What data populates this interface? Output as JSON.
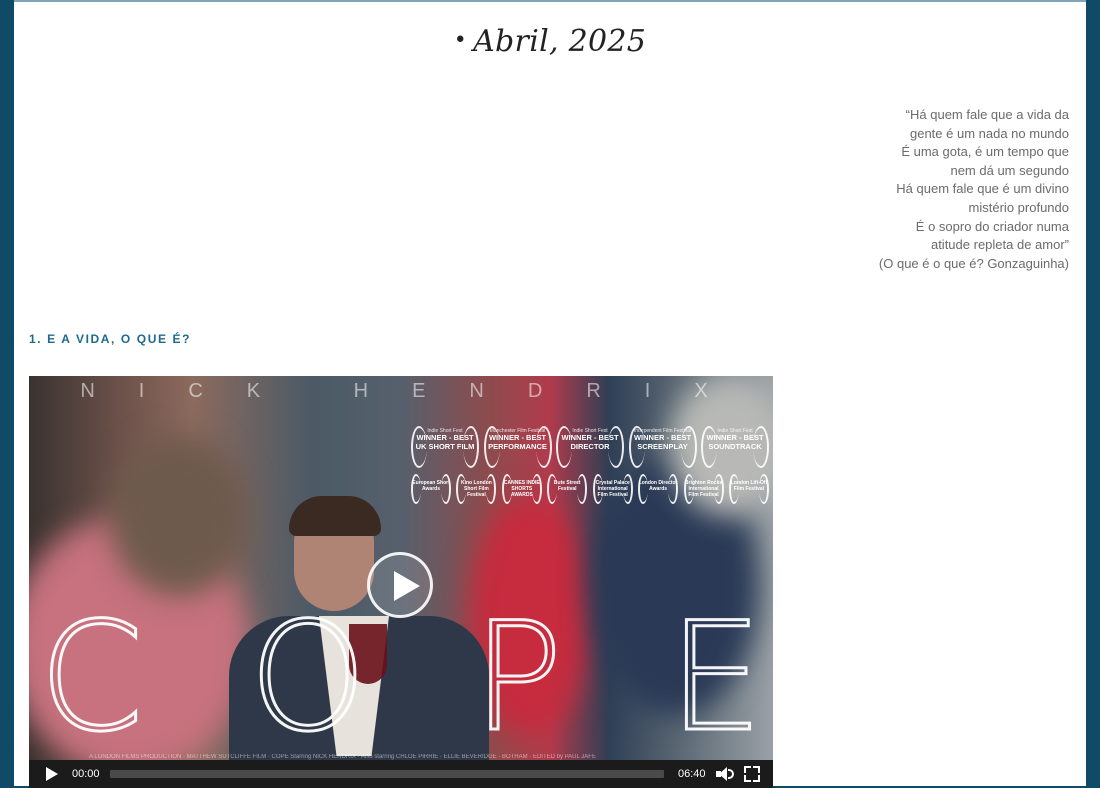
{
  "header": {
    "bullet": "•",
    "title": "Abril, 2025"
  },
  "epigraph": {
    "lines": [
      "“Há quem fale que a vida da",
      "gente é um nada no mundo",
      "É uma gota, é um tempo que",
      "nem dá um segundo",
      "Há quem fale que é um divino",
      "mistério profundo",
      "É o sopro do criador numa",
      "atitude repleta de amor”",
      "(O que é o que é? Gonzaguinha)"
    ]
  },
  "section": {
    "heading": "1. E A VIDA, O QUE É?"
  },
  "video": {
    "poster": {
      "director_name": "NICK HENDRIX",
      "title_letters": [
        "C",
        "O",
        "P",
        "E"
      ],
      "awards": [
        {
          "small": "Indie Short Fest",
          "big": "WINNER - BEST UK SHORT FILM"
        },
        {
          "small": "Manchester Film Festival",
          "big": "WINNER - BEST PERFORMANCE"
        },
        {
          "small": "Indie Short Fest",
          "big": "WINNER - BEST DIRECTOR"
        },
        {
          "small": "Independent Film Festival",
          "big": "WINNER - BEST SCREENPLAY"
        },
        {
          "small": "Indie Short Fest",
          "big": "WINNER - BEST SOUNDTRACK"
        }
      ],
      "selections": [
        "European Short Awards",
        "Kino London Short Film Festival",
        "CANNES INDIE SHORTS AWARDS",
        "Bute Street Festival",
        "Crystal Palace International Film Festival",
        "London Director Awards",
        "Brighton Rocks International Film Festival",
        "London Lift-Off Film Festival"
      ],
      "credits": "A LONDON FILMS PRODUCTION · MATTHEW SUTCLIFFE FILM · COPE Starring NICK HENDRIX · Also starring CHLOE PIRRIE · ELLIE BEVERIDGE · BOTHAM · EDITED by PAUL JAFE"
    },
    "controls": {
      "current_time": "00:00",
      "duration": "06:40",
      "progress": 0
    }
  }
}
